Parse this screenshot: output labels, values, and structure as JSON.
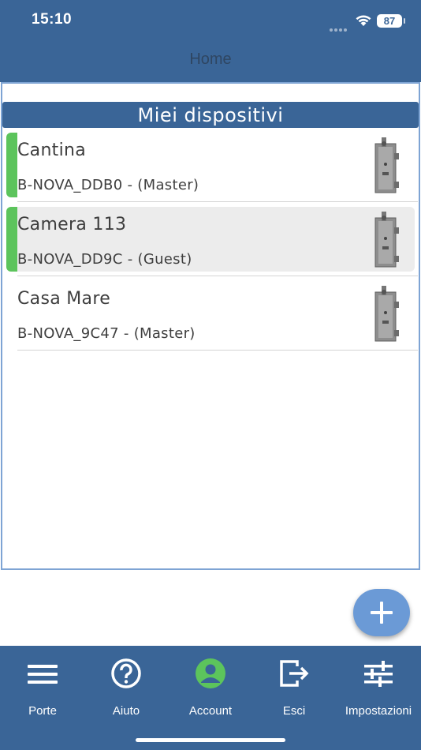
{
  "status_bar": {
    "time": "15:10",
    "battery": "87"
  },
  "nav": {
    "title": "Home"
  },
  "section": {
    "title": "Miei dispositivi"
  },
  "devices": [
    {
      "name": "Cantina",
      "subtitle": "B-NOVA_DDB0 - (Master)",
      "active": true,
      "selected": false
    },
    {
      "name": "Camera 113",
      "subtitle": "B-NOVA_DD9C - (Guest)",
      "active": true,
      "selected": true
    },
    {
      "name": "Casa Mare",
      "subtitle": "B-NOVA_9C47 - (Master)",
      "active": false,
      "selected": false
    }
  ],
  "tabs": [
    {
      "label": "Porte",
      "icon": "menu-icon"
    },
    {
      "label": "Aiuto",
      "icon": "help-icon"
    },
    {
      "label": "Account",
      "icon": "account-icon"
    },
    {
      "label": "Esci",
      "icon": "logout-icon"
    },
    {
      "label": "Impostazioni",
      "icon": "settings-sliders-icon"
    }
  ],
  "colors": {
    "primary": "#3a6597",
    "accent_green": "#5cc45c",
    "fab": "#6b9ad6"
  }
}
